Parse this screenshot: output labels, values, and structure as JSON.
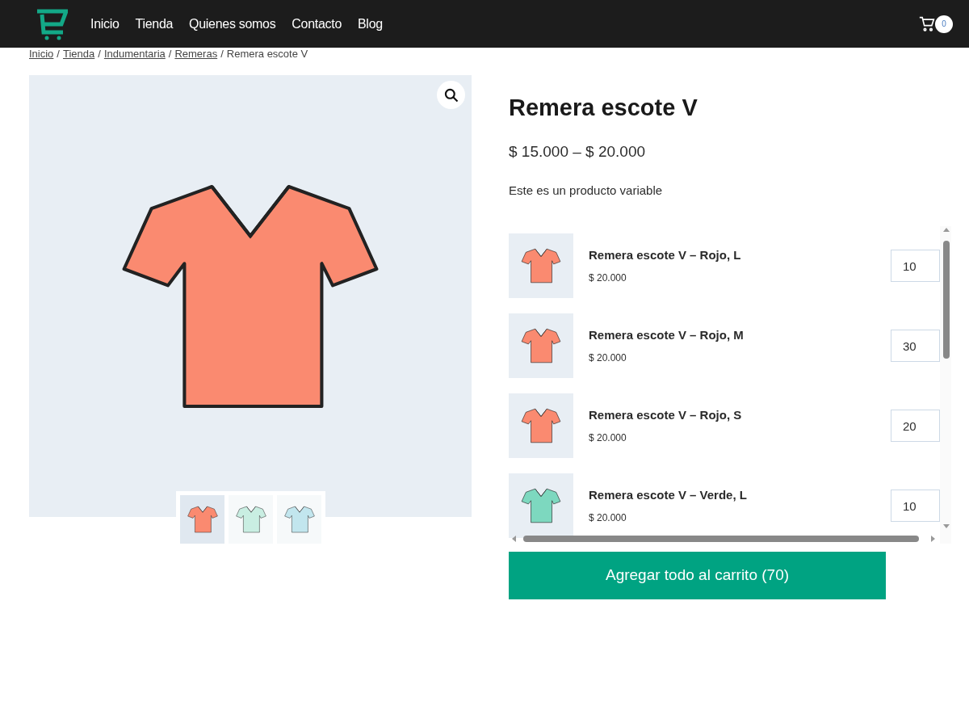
{
  "nav": {
    "items": [
      {
        "label": "Inicio"
      },
      {
        "label": "Tienda"
      },
      {
        "label": "Quienes somos"
      },
      {
        "label": "Contacto"
      },
      {
        "label": "Blog"
      }
    ],
    "cart_count": "0"
  },
  "breadcrumb": {
    "links": [
      "Inicio",
      "Tienda",
      "Indumentaria",
      "Remeras"
    ],
    "separator": "/",
    "current": "Remera escote V"
  },
  "gallery": {
    "thumbnails": [
      {
        "color": "#fa8a70",
        "selected": true
      },
      {
        "color": "#c9eee2",
        "selected": false
      },
      {
        "color": "#c2e6ee",
        "selected": false
      }
    ]
  },
  "product": {
    "title": "Remera escote V",
    "price": "$ 15.000 – $ 20.000",
    "description": "Este es un producto variable"
  },
  "variants": [
    {
      "name": "Remera escote V – Rojo, L",
      "price": "$ 20.000",
      "quantity": "10",
      "color": "#fa8a70"
    },
    {
      "name": "Remera escote V – Rojo, M",
      "price": "$ 20.000",
      "quantity": "30",
      "color": "#fa8a70"
    },
    {
      "name": "Remera escote V – Rojo, S",
      "price": "$ 20.000",
      "quantity": "20",
      "color": "#fa8a70"
    },
    {
      "name": "Remera escote V – Verde, L",
      "price": "$ 20.000",
      "quantity": "10",
      "color": "#7dd8bf"
    }
  ],
  "add_all_button": "Agregar todo al carrito (70)"
}
